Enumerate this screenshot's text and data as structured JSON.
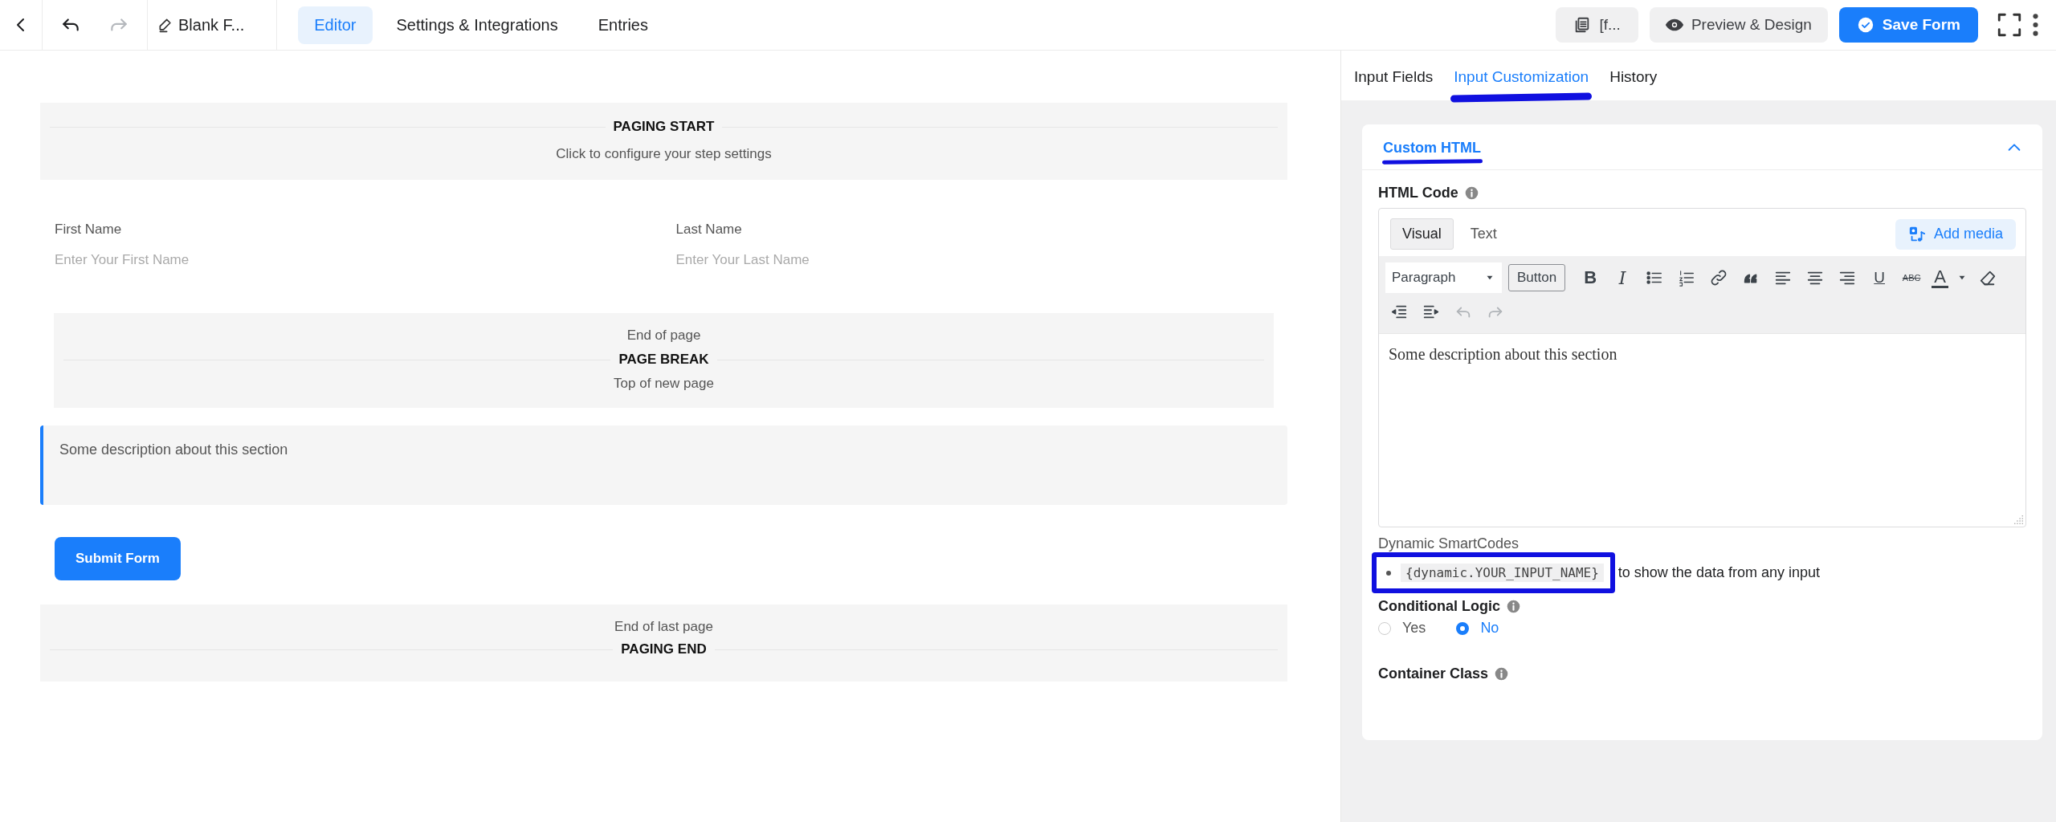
{
  "top_bar": {
    "history": [
      {
        "kind": "undo",
        "disabled": false
      },
      {
        "kind": "redo",
        "disabled": true
      }
    ],
    "title": "Blank F...",
    "tabs": [
      {
        "label": "Editor",
        "selected": true
      },
      {
        "label": "Settings & Integrations",
        "selected": false
      },
      {
        "label": "Entries",
        "selected": false
      }
    ],
    "buttons": [
      {
        "kind": "shortcode",
        "label": "[f..."
      },
      {
        "kind": "preview",
        "label": "Preview & Design"
      },
      {
        "kind": "primary",
        "label": "Save Form"
      }
    ]
  },
  "canvas": {
    "elements": [
      {
        "kind": "paging_start",
        "title": "PAGING START",
        "subtitle": "Click to configure your step settings"
      },
      {
        "kind": "name_fields",
        "fields": [
          {
            "label": "First Name",
            "placeholder": "Enter Your First Name"
          },
          {
            "label": "Last Name",
            "placeholder": "Enter Your Last Name"
          }
        ]
      },
      {
        "kind": "page_break",
        "top_text": "End of page",
        "title": "PAGE BREAK",
        "bottom_text": "Top of new page"
      },
      {
        "kind": "custom_html",
        "text": "Some description about this section",
        "selected": true
      },
      {
        "kind": "submit",
        "label": "Submit Form"
      },
      {
        "kind": "paging_end",
        "top_text": "End of last page",
        "title": "PAGING END"
      }
    ]
  },
  "panel": {
    "tabs": [
      {
        "label": "Input Fields",
        "selected": false
      },
      {
        "label": "Input Customization",
        "selected": true
      },
      {
        "label": "History",
        "selected": false
      }
    ],
    "section": {
      "title": "Custom HTML",
      "expanded": true
    },
    "html_code": {
      "label": "HTML Code",
      "modes": [
        {
          "label": "Visual",
          "selected": true
        },
        {
          "label": "Text",
          "selected": false
        }
      ],
      "add_media": "Add media",
      "toolbar_rows": [
        [
          {
            "kind": "format",
            "label": "Paragraph"
          },
          {
            "kind": "text_button",
            "label": "Button"
          },
          {
            "kind": "bold",
            "glyph": "B"
          },
          {
            "kind": "italic",
            "glyph": "I"
          },
          {
            "kind": "bullet_list"
          },
          {
            "kind": "number_list"
          },
          {
            "kind": "link"
          },
          {
            "kind": "quote"
          },
          {
            "kind": "align_left"
          },
          {
            "kind": "align_center"
          },
          {
            "kind": "align_right"
          },
          {
            "kind": "underline",
            "glyph": "U"
          },
          {
            "kind": "strikethrough",
            "glyph": "ABC"
          },
          {
            "kind": "text_color",
            "glyph": "A"
          },
          {
            "kind": "eraser"
          }
        ],
        [
          {
            "kind": "outdent"
          },
          {
            "kind": "indent"
          },
          {
            "kind": "undo",
            "disabled": true
          },
          {
            "kind": "redo",
            "disabled": true
          }
        ]
      ],
      "content": "Some description about this section"
    },
    "smartcodes": {
      "title": "Dynamic SmartCodes",
      "items": [
        {
          "code": "{dynamic.YOUR_INPUT_NAME}",
          "text": "to show the data from any input"
        }
      ]
    },
    "conditional_logic": {
      "label": "Conditional Logic",
      "options": [
        {
          "label": "Yes",
          "selected": false
        },
        {
          "label": "No",
          "selected": true
        }
      ]
    },
    "container_class": {
      "label": "Container Class"
    }
  }
}
